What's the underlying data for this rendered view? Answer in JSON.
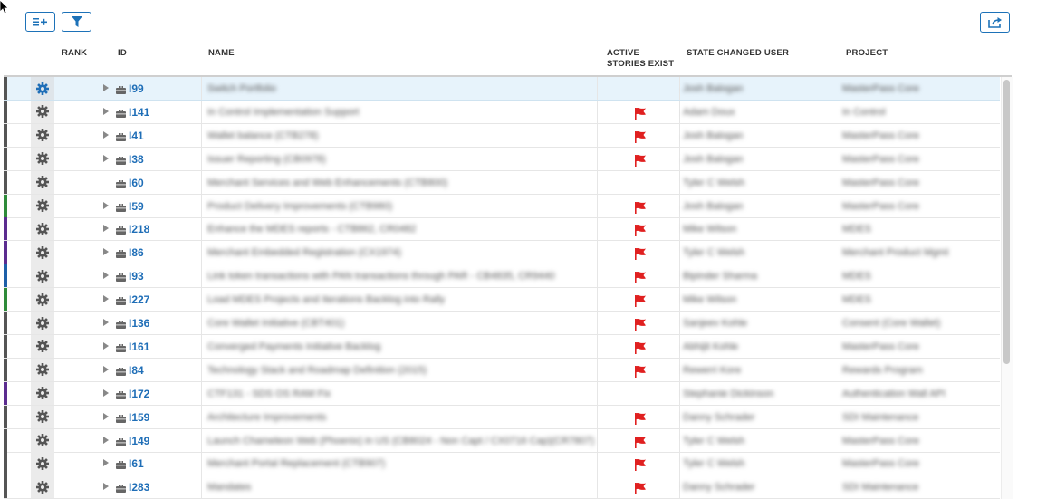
{
  "headers": {
    "rank": "RANK",
    "id": "ID",
    "name": "NAME",
    "active_line1": "ACTIVE",
    "active_line2": "STORIES EXIST",
    "state_user": "STATE CHANGED USER",
    "project": "PROJECT"
  },
  "toolbar": {
    "add_icon": "list-add-icon",
    "filter_icon": "filter-icon",
    "export_icon": "export-icon"
  },
  "colors": {
    "accent": "#1f6eb7",
    "flag": "#e02020",
    "selected_row": "#e7f3fb"
  },
  "rows": [
    {
      "id": "I99",
      "name": "Switch Portfolio",
      "user": "Josh Balogan",
      "project": "MasterPass Core",
      "flag": false,
      "strip": "#555555",
      "expandable": true,
      "selected": true
    },
    {
      "id": "I141",
      "name": "In Control Implementation Support",
      "user": "Adam Doux",
      "project": "In Control",
      "flag": true,
      "strip": "#555555",
      "expandable": true,
      "selected": false
    },
    {
      "id": "I41",
      "name": "Wallet balance (CTB278)",
      "user": "Josh Balogan",
      "project": "MasterPass Core",
      "flag": true,
      "strip": "#555555",
      "expandable": true,
      "selected": false
    },
    {
      "id": "I38",
      "name": "Issuer Reporting (CB0978)",
      "user": "Josh Balogan",
      "project": "MasterPass Core",
      "flag": true,
      "strip": "#555555",
      "expandable": true,
      "selected": false
    },
    {
      "id": "I60",
      "name": "Merchant Services and Web Enhancements (CTB800)",
      "user": "Tyler C Welsh",
      "project": "MasterPass Core",
      "flag": false,
      "strip": "#555555",
      "expandable": false,
      "selected": false
    },
    {
      "id": "I59",
      "name": "Product Delivery Improvements (CTB980)",
      "user": "Josh Balogan",
      "project": "MasterPass Core",
      "flag": true,
      "strip": "#2e8b3a",
      "expandable": true,
      "selected": false
    },
    {
      "id": "I218",
      "name": "Enhance the MDES reports - CTB862, CR0482",
      "user": "Mike Wilson",
      "project": "MDES",
      "flag": true,
      "strip": "#5b2c8f",
      "expandable": true,
      "selected": false
    },
    {
      "id": "I86",
      "name": "Merchant Embedded Registration (CX1974)",
      "user": "Tyler C Welsh",
      "project": "Merchant Product Mgmt",
      "flag": true,
      "strip": "#5b2c8f",
      "expandable": true,
      "selected": false
    },
    {
      "id": "I93",
      "name": "Link token transactions with PAN transactions through PAR - CB4835, CR9440",
      "user": "Bipinder Sharma",
      "project": "MDES",
      "flag": true,
      "strip": "#1d5fa8",
      "expandable": true,
      "selected": false
    },
    {
      "id": "I227",
      "name": "Load MDES Projects and Iterations Backlog into Rally",
      "user": "Mike Wilson",
      "project": "MDES",
      "flag": true,
      "strip": "#2e8b3a",
      "expandable": true,
      "selected": false
    },
    {
      "id": "I136",
      "name": "Core Wallet Initiative (CBT401)",
      "user": "Sanjeev Kohle",
      "project": "Consent (Core Wallet)",
      "flag": true,
      "strip": "#555555",
      "expandable": true,
      "selected": false
    },
    {
      "id": "I161",
      "name": "Converged Payments Initiative Backlog",
      "user": "Abhijit Kohle",
      "project": "MasterPass Core",
      "flag": true,
      "strip": "#555555",
      "expandable": true,
      "selected": false
    },
    {
      "id": "I84",
      "name": "Technology Stack and Roadmap Definition (2015)",
      "user": "Rewerri Kore",
      "project": "Rewards Program",
      "flag": true,
      "strip": "#555555",
      "expandable": true,
      "selected": false
    },
    {
      "id": "I172",
      "name": "CTF131 - SDS OS RAM Fix",
      "user": "Stephanie Dickinson",
      "project": "Authentication Wall API",
      "flag": false,
      "strip": "#5b2c8f",
      "expandable": true,
      "selected": false
    },
    {
      "id": "I159",
      "name": "Architecture Improvements",
      "user": "Danny Schrader",
      "project": "SDI Maintenance",
      "flag": true,
      "strip": "#555555",
      "expandable": true,
      "selected": false
    },
    {
      "id": "I149",
      "name": "Launch Chameleon Web (Phoenix) in US (CB8024 - Non Capt / CX0716 Cap)(CR7807)",
      "user": "Tyler C Welsh",
      "project": "MasterPass Core",
      "flag": true,
      "strip": "#555555",
      "expandable": true,
      "selected": false
    },
    {
      "id": "I61",
      "name": "Merchant Portal Replacement (CTB907)",
      "user": "Tyler C Welsh",
      "project": "MasterPass Core",
      "flag": true,
      "strip": "#555555",
      "expandable": true,
      "selected": false
    },
    {
      "id": "I283",
      "name": "Mandates",
      "user": "Danny Schrader",
      "project": "SDI Maintenance",
      "flag": true,
      "strip": "#555555",
      "expandable": true,
      "selected": false
    }
  ]
}
